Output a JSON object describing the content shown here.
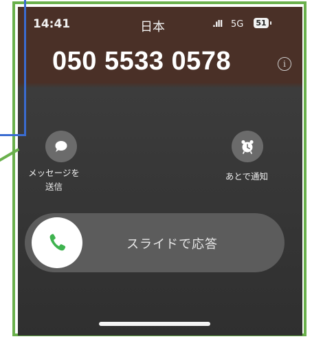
{
  "status_bar": {
    "time": "14:41",
    "carrier": "日本",
    "signal": ".ıll",
    "network": "5G",
    "battery": "51"
  },
  "caller": {
    "number": "050 5533 0578"
  },
  "actions": {
    "message_label_line1": "メッセージを",
    "message_label_line2": "送信",
    "remind_label": "あとで通知"
  },
  "slider": {
    "label": "スライドで応答"
  },
  "colors": {
    "accept_green": "#3fb34f",
    "frame_green": "#6ab04c",
    "frame_blue": "#3a6cd1"
  },
  "icons": {
    "info": "info-icon",
    "message": "message-bubble-icon",
    "remind": "alarm-clock-icon",
    "accept": "phone-icon"
  }
}
